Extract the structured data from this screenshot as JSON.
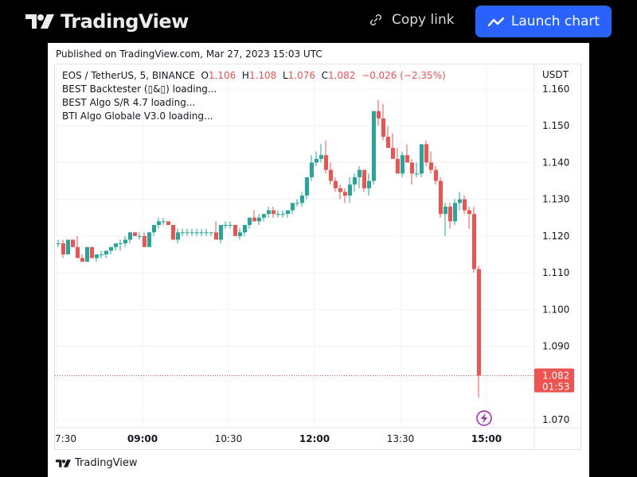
{
  "header": {
    "brand": "TradingView",
    "copy_link_label": "Copy link",
    "launch_chart_label": "Launch chart",
    "accent": "#2962ff"
  },
  "published": "Published on TradingView.com, Mar 27, 2023 15:03 UTC",
  "legend": {
    "symbol": "EOS / TetherUS, 5, BINANCE",
    "o_label": "O",
    "o_value": "1.106",
    "h_label": "H",
    "h_value": "1.108",
    "l_label": "L",
    "l_value": "1.076",
    "c_label": "C",
    "c_value": "1.082",
    "change": "−0.026 (−2.35%)",
    "indicators": [
      "BEST Backtester (▯&▯) loading...",
      "BEST Algo S/R 4.7 loading...",
      "BTI Algo Globale V3.0 loading..."
    ]
  },
  "footer_brand": "TradingView",
  "chart_data": {
    "type": "candlestick",
    "title": "EOS / TetherUS, 5, BINANCE",
    "currency": "USDT",
    "interval_minutes": 5,
    "up_color": "#26a69a",
    "down_color": "#ef5350",
    "ylim": [
      1.067,
      1.163
    ],
    "y_ticks": [
      "1.160",
      "1.150",
      "1.140",
      "1.130",
      "1.120",
      "1.110",
      "1.100",
      "1.090",
      "1.070"
    ],
    "x_ticks": [
      {
        "label": "7:30",
        "bold": false,
        "index": 0
      },
      {
        "label": "09:00",
        "bold": true,
        "index": 18
      },
      {
        "label": "10:30",
        "bold": false,
        "index": 36
      },
      {
        "label": "12:00",
        "bold": true,
        "index": 54
      },
      {
        "label": "13:30",
        "bold": false,
        "index": 72
      },
      {
        "label": "15:00",
        "bold": true,
        "index": 90
      }
    ],
    "last_price": {
      "value": "1.082",
      "countdown": "01:53",
      "price": 1.082
    },
    "candles": [
      [
        1.118,
        1.119,
        1.117,
        1.118
      ],
      [
        1.118,
        1.119,
        1.114,
        1.115
      ],
      [
        1.115,
        1.119,
        1.115,
        1.119
      ],
      [
        1.119,
        1.119,
        1.117,
        1.117
      ],
      [
        1.117,
        1.12,
        1.114,
        1.114
      ],
      [
        1.114,
        1.115,
        1.113,
        1.113
      ],
      [
        1.113,
        1.117,
        1.113,
        1.117
      ],
      [
        1.117,
        1.117,
        1.114,
        1.114
      ],
      [
        1.114,
        1.115,
        1.113,
        1.115
      ],
      [
        1.115,
        1.116,
        1.114,
        1.115
      ],
      [
        1.115,
        1.116,
        1.114,
        1.116
      ],
      [
        1.116,
        1.117,
        1.115,
        1.117
      ],
      [
        1.117,
        1.118,
        1.116,
        1.118
      ],
      [
        1.118,
        1.119,
        1.116,
        1.118
      ],
      [
        1.118,
        1.12,
        1.117,
        1.119
      ],
      [
        1.119,
        1.121,
        1.118,
        1.121
      ],
      [
        1.121,
        1.121,
        1.12,
        1.12
      ],
      [
        1.12,
        1.121,
        1.119,
        1.12
      ],
      [
        1.12,
        1.121,
        1.117,
        1.117
      ],
      [
        1.117,
        1.121,
        1.117,
        1.121
      ],
      [
        1.121,
        1.123,
        1.12,
        1.123
      ],
      [
        1.123,
        1.125,
        1.122,
        1.124
      ],
      [
        1.124,
        1.125,
        1.123,
        1.124
      ],
      [
        1.124,
        1.124,
        1.123,
        1.123
      ],
      [
        1.123,
        1.123,
        1.119,
        1.119
      ],
      [
        1.119,
        1.122,
        1.118,
        1.121
      ],
      [
        1.121,
        1.122,
        1.12,
        1.121
      ],
      [
        1.121,
        1.122,
        1.12,
        1.121
      ],
      [
        1.121,
        1.122,
        1.12,
        1.121
      ],
      [
        1.121,
        1.122,
        1.12,
        1.121
      ],
      [
        1.121,
        1.122,
        1.12,
        1.121
      ],
      [
        1.121,
        1.122,
        1.12,
        1.121
      ],
      [
        1.121,
        1.121,
        1.12,
        1.121
      ],
      [
        1.121,
        1.124,
        1.119,
        1.119
      ],
      [
        1.119,
        1.123,
        1.118,
        1.123
      ],
      [
        1.123,
        1.124,
        1.122,
        1.123
      ],
      [
        1.123,
        1.124,
        1.122,
        1.123
      ],
      [
        1.123,
        1.123,
        1.12,
        1.12
      ],
      [
        1.12,
        1.122,
        1.119,
        1.121
      ],
      [
        1.121,
        1.123,
        1.12,
        1.123
      ],
      [
        1.123,
        1.125,
        1.122,
        1.125
      ],
      [
        1.125,
        1.127,
        1.124,
        1.124
      ],
      [
        1.124,
        1.126,
        1.123,
        1.125
      ],
      [
        1.125,
        1.126,
        1.124,
        1.126
      ],
      [
        1.126,
        1.128,
        1.125,
        1.127
      ],
      [
        1.127,
        1.128,
        1.125,
        1.126
      ],
      [
        1.126,
        1.127,
        1.125,
        1.126
      ],
      [
        1.126,
        1.127,
        1.125,
        1.126
      ],
      [
        1.126,
        1.127,
        1.125,
        1.127
      ],
      [
        1.127,
        1.129,
        1.126,
        1.129
      ],
      [
        1.129,
        1.13,
        1.128,
        1.129
      ],
      [
        1.129,
        1.132,
        1.128,
        1.131
      ],
      [
        1.131,
        1.136,
        1.13,
        1.136
      ],
      [
        1.136,
        1.142,
        1.135,
        1.14
      ],
      [
        1.14,
        1.143,
        1.139,
        1.141
      ],
      [
        1.141,
        1.145,
        1.14,
        1.142
      ],
      [
        1.142,
        1.146,
        1.137,
        1.138
      ],
      [
        1.138,
        1.14,
        1.134,
        1.135
      ],
      [
        1.135,
        1.136,
        1.132,
        1.133
      ],
      [
        1.133,
        1.134,
        1.13,
        1.132
      ],
      [
        1.132,
        1.133,
        1.129,
        1.131
      ],
      [
        1.131,
        1.136,
        1.129,
        1.134
      ],
      [
        1.134,
        1.137,
        1.132,
        1.136
      ],
      [
        1.136,
        1.139,
        1.133,
        1.138
      ],
      [
        1.138,
        1.138,
        1.132,
        1.133
      ],
      [
        1.133,
        1.137,
        1.131,
        1.135
      ],
      [
        1.135,
        1.154,
        1.134,
        1.154
      ],
      [
        1.154,
        1.157,
        1.15,
        1.152
      ],
      [
        1.152,
        1.156,
        1.146,
        1.147
      ],
      [
        1.147,
        1.15,
        1.144,
        1.144
      ],
      [
        1.144,
        1.148,
        1.141,
        1.141
      ],
      [
        1.141,
        1.144,
        1.137,
        1.137
      ],
      [
        1.137,
        1.143,
        1.136,
        1.142
      ],
      [
        1.142,
        1.145,
        1.14,
        1.14
      ],
      [
        1.14,
        1.141,
        1.134,
        1.137
      ],
      [
        1.137,
        1.14,
        1.136,
        1.137
      ],
      [
        1.137,
        1.145,
        1.136,
        1.145
      ],
      [
        1.145,
        1.146,
        1.139,
        1.14
      ],
      [
        1.14,
        1.143,
        1.137,
        1.138
      ],
      [
        1.138,
        1.139,
        1.134,
        1.135
      ],
      [
        1.135,
        1.136,
        1.125,
        1.126
      ],
      [
        1.126,
        1.129,
        1.12,
        1.128
      ],
      [
        1.128,
        1.129,
        1.122,
        1.124
      ],
      [
        1.124,
        1.13,
        1.123,
        1.129
      ],
      [
        1.129,
        1.132,
        1.127,
        1.13
      ],
      [
        1.13,
        1.131,
        1.126,
        1.127
      ],
      [
        1.127,
        1.128,
        1.122,
        1.126
      ],
      [
        1.126,
        1.128,
        1.11,
        1.111
      ],
      [
        1.111,
        1.112,
        1.076,
        1.082
      ]
    ]
  }
}
